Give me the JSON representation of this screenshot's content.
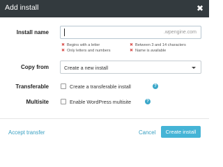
{
  "dialog": {
    "title": "Add install",
    "close_glyph": "✖"
  },
  "install_name": {
    "label": "Install name",
    "value": "",
    "suffix": ".wpengine.com",
    "rules": [
      "Begins with a letter",
      "Only letters and numbers",
      "Between 3 and 14 characters",
      "Name is available"
    ],
    "rule_mark": "✖",
    "rule_mark_color": "#d9534f"
  },
  "copy_from": {
    "label": "Copy from",
    "selected": "Create a new install"
  },
  "transferable": {
    "label": "Transferable",
    "checkbox_label": "Create a transferable install",
    "checked": false,
    "help_glyph": "?"
  },
  "multisite": {
    "label": "Multisite",
    "checkbox_label": "Enable WordPress multisite",
    "checked": false,
    "help_glyph": "?"
  },
  "footer": {
    "accept_transfer": "Accept transfer",
    "cancel": "Cancel",
    "create": "Create install"
  },
  "colors": {
    "titlebar": "#333a3e",
    "accent": "#45b4d6",
    "link": "#39a0c2",
    "error": "#d9534f"
  }
}
